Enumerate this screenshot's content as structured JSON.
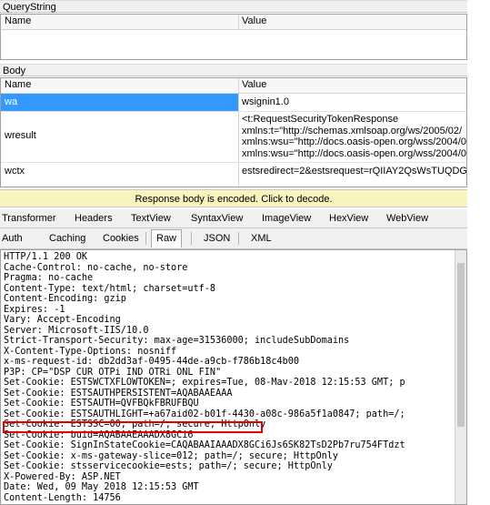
{
  "querystring": {
    "title": "QueryString",
    "col_name": "Name",
    "col_value": "Value"
  },
  "body_section": {
    "title": "Body",
    "col_name": "Name",
    "col_value": "Value",
    "rows": [
      {
        "name": "wa",
        "value": "wsignin1.0"
      },
      {
        "name": "wresult",
        "value": "<t:RequestSecurityTokenResponse\nxmlns:t=\"http://schemas.xmlsoap.org/ws/2005/02/\nxmlns:wsu=\"http://docs.oasis-open.org/wss/2004/0\nxmlns:wsu=\"http://docs.oasis-open.org/wss/2004/0"
      },
      {
        "name": "wctx",
        "value": "estsredirect=2&estsrequest=rQIIAY2QsWsTUQDG8"
      }
    ]
  },
  "banner": "Response body is encoded. Click to decode.",
  "tabs_row1": [
    "Transformer",
    "Headers",
    "TextView",
    "SyntaxView",
    "ImageView",
    "HexView",
    "WebView"
  ],
  "tabs_row2": [
    "Auth",
    "Caching",
    "Cookies",
    "Raw",
    "JSON",
    "XML"
  ],
  "active_tab": "Raw",
  "raw_text": "HTTP/1.1 200 OK\nCache-Control: no-cache, no-store\nPragma: no-cache\nContent-Type: text/html; charset=utf-8\nContent-Encoding: gzip\nExpires: -1\nVary: Accept-Encoding\nServer: Microsoft-IIS/10.0\nStrict-Transport-Security: max-age=31536000; includeSubDomains\nX-Content-Type-Options: nosniff\nx-ms-request-id: db2dd3af-0495-44de-a9cb-f786b18c4b00\nP3P: CP=\"DSP CUR OTPi IND OTRi ONL FIN\"\nSet-Cookie: ESTSWCTXFLOWTOKEN=; expires=Tue, 08-Mav-2018 12:15:53 GMT; p\nSet-Cookie: ESTSAUTHPERSISTENT=AQABAAEAAA\nSet-Cookie: ESTSAUTH=QVFBQkFBRUFBQU\nSet-Cookie: ESTSAUTHLIGHT=+a67aid02-b01f-4430-a08c-986a5f1a0847; path=/;\nSet-Cookie: ESTSSC=00; path=/; secure; HttpOnly\nSet-Cookie: buid=AQABAAEAAADX8GCi6\nSet-Cookie: SignInStateCookie=CAQABAAIAAADX8GCi6Js6SK82TsD2Pb7ru754FTdzt\nSet-Cookie: x-ms-gateway-slice=012; path=/; secure; HttpOnly\nSet-Cookie: stsservicecookie=ests; path=/; secure; HttpOnly\nX-Powered-By: ASP.NET\nDate: Wed, 09 May 2018 12:15:53 GMT\nContent-Length: 14756"
}
